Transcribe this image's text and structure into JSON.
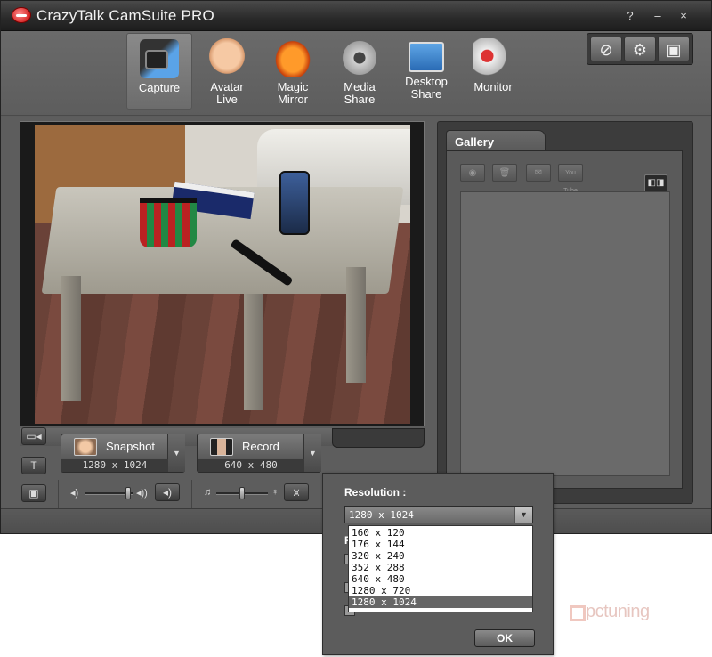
{
  "window": {
    "title": "CrazyTalk CamSuite PRO",
    "help_label": "?",
    "minimize_label": "–",
    "close_label": "×"
  },
  "toolbar": {
    "modes": [
      {
        "label": "Capture",
        "icon": "camera-icon"
      },
      {
        "label": "Avatar\nLive",
        "icon": "avatar-icon"
      },
      {
        "label": "Magic\nMirror",
        "icon": "mask-icon"
      },
      {
        "label": "Media\nShare",
        "icon": "film-reel-icon"
      },
      {
        "label": "Desktop\nShare",
        "icon": "monitors-icon"
      },
      {
        "label": "Monitor",
        "icon": "security-camera-icon"
      }
    ],
    "active_mode": "Capture",
    "right_buttons": [
      {
        "icon": "no-share-icon",
        "glyph": "⊘"
      },
      {
        "icon": "gear-icon",
        "glyph": "⚙"
      },
      {
        "icon": "webcam-settings-icon",
        "glyph": "▣"
      }
    ]
  },
  "gallery": {
    "tab_label": "Gallery",
    "tools": [
      {
        "icon": "view-icon",
        "glyph": "◉"
      },
      {
        "icon": "trash-icon",
        "glyph": "🗑"
      },
      {
        "icon": "mail-icon",
        "glyph": "✉"
      },
      {
        "icon": "youtube-icon",
        "glyph": "You Tube"
      }
    ],
    "view_toggle_glyph": "◧◨"
  },
  "capture": {
    "snapshot": {
      "label": "Snapshot",
      "resolution": "1280 x 1024"
    },
    "record": {
      "label": "Record",
      "resolution": "640 x 480"
    },
    "dropdown_glyph": "▼",
    "side_buttons": [
      {
        "icon": "camera-settings-icon",
        "glyph": "▭◂"
      },
      {
        "icon": "text-tool-icon",
        "glyph": "T"
      },
      {
        "icon": "photo-frame-icon",
        "glyph": "▣"
      }
    ],
    "volume": {
      "low_glyph": "◂)",
      "high_glyph": "◂))",
      "speaker_glyph": "◂)"
    },
    "mic": {
      "note_glyph": "♫",
      "mic_glyph": "♀",
      "eq_glyph": "⩙"
    }
  },
  "resolution_popup": {
    "label": "Resolution :",
    "selected": "1280 x 1024",
    "options": [
      "160 x 120",
      "176 x 144",
      "320 x 240",
      "352 x 288",
      "640 x 480",
      "1280 x 720",
      "1280 x 1024"
    ],
    "ok_label": "OK",
    "partial_label": "R",
    "arrow_glyph": "▼"
  },
  "watermark": {
    "text": "pctuning"
  },
  "colors": {
    "window_bg": "#5c5c5c",
    "titlebar": "#2a2a2a",
    "selected_option": "#666666",
    "logo_red": "#c40000",
    "watermark": "#e7c6c0"
  }
}
